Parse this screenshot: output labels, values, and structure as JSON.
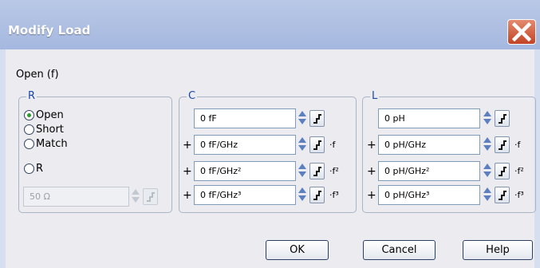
{
  "dialog": {
    "title": "Modify Load",
    "subtitle": "Open (f)"
  },
  "r_group": {
    "title": "R",
    "options": [
      {
        "label": "Open",
        "selected": true
      },
      {
        "label": "Short",
        "selected": false
      },
      {
        "label": "Match",
        "selected": false
      },
      {
        "label": "R",
        "selected": false
      }
    ],
    "r_value": "50 Ω"
  },
  "c_group": {
    "title": "C",
    "rows": [
      {
        "prefix": "",
        "value": "0 fF",
        "suffix": ""
      },
      {
        "prefix": "+",
        "value": "0 fF/GHz",
        "suffix": "·f"
      },
      {
        "prefix": "+",
        "value": "0 fF/GHz²",
        "suffix": "·f²"
      },
      {
        "prefix": "+",
        "value": "0 fF/GHz³",
        "suffix": "·f³"
      }
    ]
  },
  "l_group": {
    "title": "L",
    "rows": [
      {
        "prefix": "",
        "value": "0 pH",
        "suffix": ""
      },
      {
        "prefix": "+",
        "value": "0 pH/GHz",
        "suffix": "·f"
      },
      {
        "prefix": "+",
        "value": "0 pH/GHz²",
        "suffix": "·f²"
      },
      {
        "prefix": "+",
        "value": "0 pH/GHz³",
        "suffix": "·f³"
      }
    ]
  },
  "buttons": {
    "ok": "OK",
    "cancel": "Cancel",
    "help": "Help"
  },
  "colors": {
    "title_bar": "#a5b8df",
    "client": "#ebebf0",
    "group_title": "#1a49a8",
    "close_button": "#c24325"
  }
}
